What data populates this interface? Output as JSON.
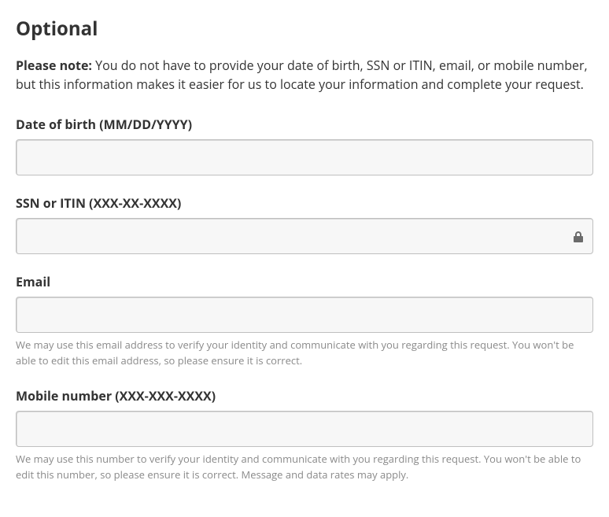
{
  "heading": "Optional",
  "note": {
    "strong": "Please note:",
    "text": " You do not have to provide your date of birth, SSN or ITIN, email, or mobile number, but this information makes it easier for us to locate your information and complete your request."
  },
  "fields": {
    "dob": {
      "label": "Date of birth (MM/DD/YYYY)",
      "value": ""
    },
    "ssn": {
      "label": "SSN or ITIN (XXX-XX-XXXX)",
      "value": ""
    },
    "email": {
      "label": "Email",
      "value": "",
      "helper": "We may use this email address to verify your identity and communicate with you regarding this request. You won't be able to edit this email address, so please ensure it is correct."
    },
    "mobile": {
      "label": "Mobile number (XXX-XXX-XXXX)",
      "value": "",
      "helper": "We may use this number to verify your identity and communicate with you regarding this request. You won't be able to edit this number, so please ensure it is correct. Message and data rates may apply."
    }
  }
}
